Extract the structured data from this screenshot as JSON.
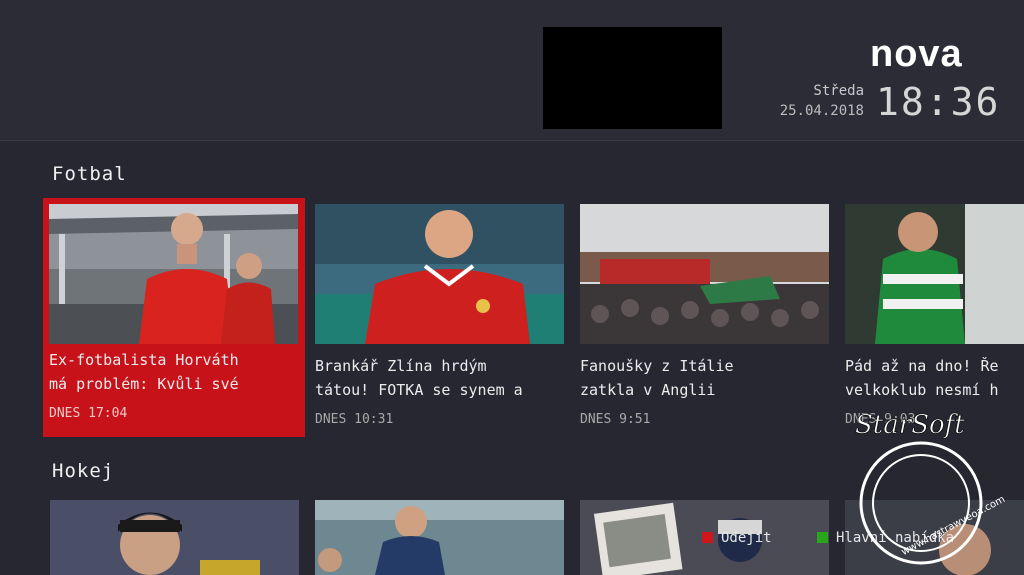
{
  "header": {
    "logo_text": "nova",
    "day": "Středa",
    "date": "25.04.2018",
    "time": "18:36"
  },
  "sections": [
    {
      "title": "Fotbal",
      "cards": [
        {
          "title_line1": "Ex-fotbalista Horváth",
          "title_line2": "má problém: Kvůli své",
          "time": "DNES 17:04"
        },
        {
          "title_line1": "Brankář Zlína hrdým",
          "title_line2": "tátou! FOTKA se synem a",
          "time": "DNES 10:31"
        },
        {
          "title_line1": "Fanoušky z Itálie",
          "title_line2": "zatkla v Anglii",
          "time": "DNES 9:51"
        },
        {
          "title_line1": "Pád až na dno! Ře",
          "title_line2": "velkoklub nesmí h",
          "time": "DNES 9:03"
        }
      ]
    },
    {
      "title": "Hokej"
    }
  ],
  "legend": {
    "exit_label": "Odejít",
    "main_label": "Hlavní nabídka",
    "exit_color": "#d0161c",
    "main_color": "#2aa61c"
  },
  "watermark": {
    "text": "StarSoft",
    "url": "www.hastrawyeoa.com"
  }
}
